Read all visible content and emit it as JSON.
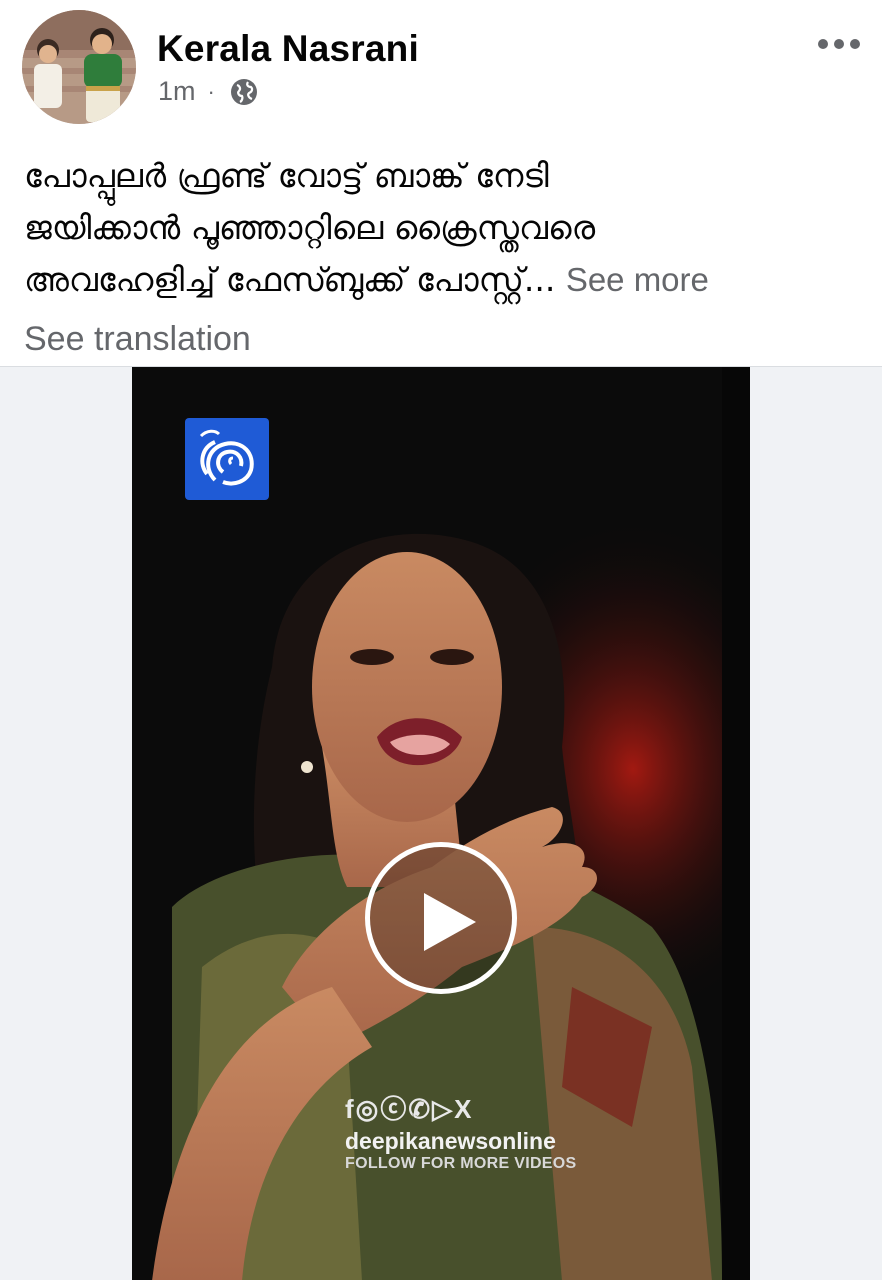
{
  "post": {
    "author": "Kerala Nasrani",
    "time": "1m",
    "separator": "·",
    "audience_icon": "globe-icon",
    "caption_lines": [
      "പോപ്പുലർ ഫ്രണ്ട് വോട്ട് ബാങ്ക് നേടി",
      "ജയിക്കാൻ പൂഞ്ഞാറ്റിലെ ക്രൈസ്തവരെ",
      "അവഹേളിച്ച് ഫേസ്ബുക്ക് പോസ്റ്റ്..."
    ],
    "see_more": "See more",
    "see_translation": "See translation"
  },
  "video": {
    "watermark_icons": "f◎ⓒ✆▷X",
    "watermark_handle": "deepikanewsonline",
    "watermark_follow": "FOLLOW FOR MORE VIDEOS",
    "channel_logo": "deepika-logo-icon",
    "play_icon": "play-icon"
  },
  "colors": {
    "text_primary": "#050505",
    "text_secondary": "#65676b",
    "logo_blue": "#1f5bd6",
    "media_background": "#f0f2f5"
  }
}
